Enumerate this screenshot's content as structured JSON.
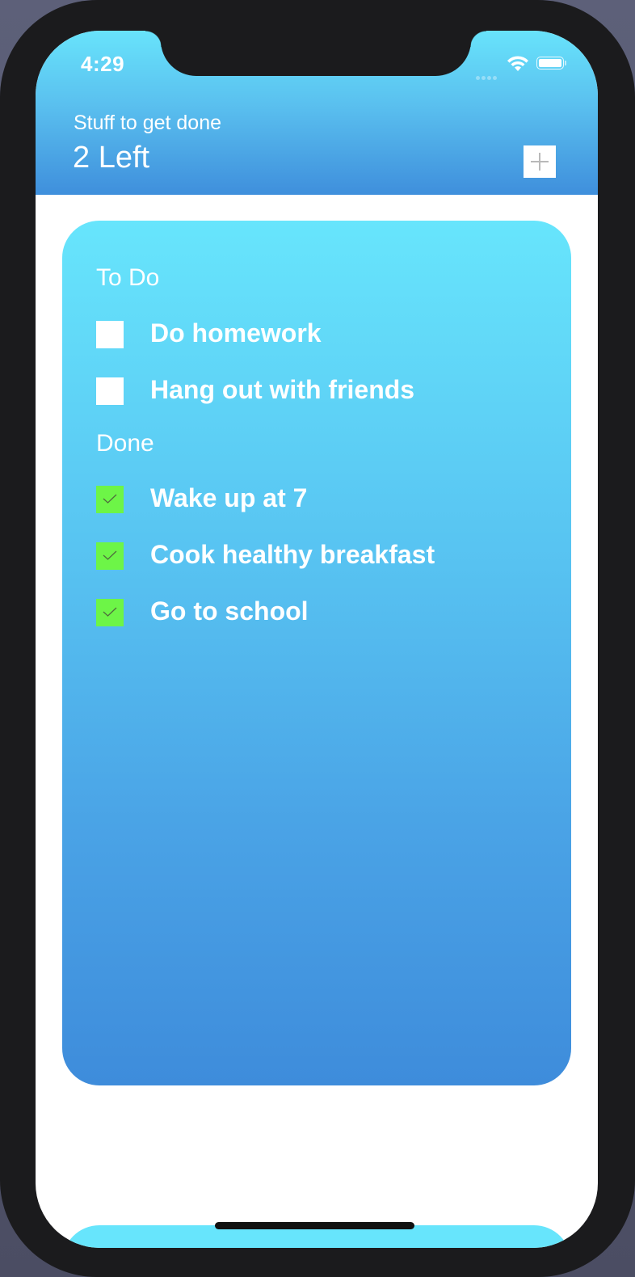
{
  "status_bar": {
    "time": "4:29",
    "icons": [
      "signal-icon",
      "wifi-icon",
      "battery-icon"
    ]
  },
  "header": {
    "subtitle": "Stuff to get done",
    "title": "2 Left",
    "add_icon": "plus-icon"
  },
  "todo_section": {
    "label": "To Do",
    "items": [
      {
        "label": "Do homework",
        "checked": false
      },
      {
        "label": "Hang out with friends",
        "checked": false
      }
    ]
  },
  "done_section": {
    "label": "Done",
    "items": [
      {
        "label": "Wake up at 7",
        "checked": true
      },
      {
        "label": "Cook healthy breakfast",
        "checked": true
      },
      {
        "label": "Go to school",
        "checked": true
      }
    ]
  },
  "colors": {
    "gradient_top": "#67e5fc",
    "gradient_bottom": "#3e8cdb",
    "checked": "#6df547",
    "unchecked": "#ffffff"
  }
}
